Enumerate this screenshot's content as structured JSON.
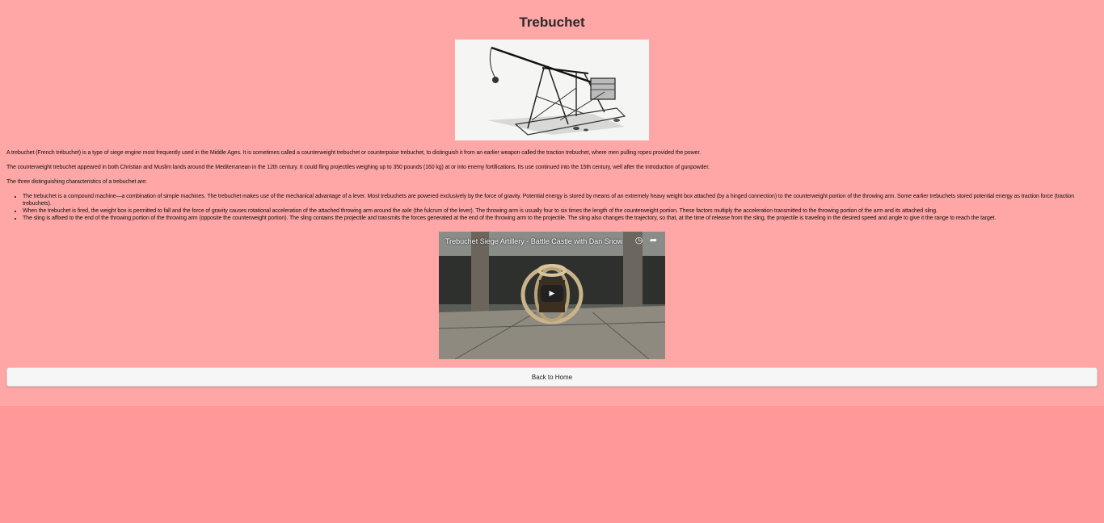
{
  "title": "Trebuchet",
  "image": {
    "icon": "trebuchet-illustration"
  },
  "paragraphs": {
    "intro": "A trebuchet (French trébuchet) is a type of siege engine most frequently used in the Middle Ages. It is sometimes called a counterweight trebuchet or counterpoise trebuchet, to distinguish it from an earlier weapon called the traction trebuchet, where men pulling ropes provided the power.",
    "history": "The counterweight trebuchet appeared in both Christian and Muslim lands around the Mediterranean in the 12th century. It could fling projectiles weighing up to 350 pounds (160 kg) at or into enemy fortifications. Its use continued into the 15th century, well after the introduction of gunpowder.",
    "lead": "The three distinguishing characteristics of a trebuchet are:"
  },
  "characteristics": [
    "The trebuchet is a compound machine—a combination of simple machines. The trebuchet makes use of the mechanical advantage of a lever. Most trebuchets are powered exclusively by the force of gravity. Potential energy is stored by means of an extremely heavy weight box attached (by a hinged connection) to the counterweight portion of the throwing arm. Some earlier trebuchets stored potential energy as traction force (traction trebuchets).",
    "When the trebuchet is fired, the weight box is permitted to fall and the force of gravity causes rotational acceleration of the attached throwing arm around the axle (the fulcrum of the lever). The throwing arm is usually four to six times the length of the counterweight portion. These factors multiply the acceleration transmitted to the throwing portion of the arm and its attached sling.",
    "The sling is affixed to the end of the throwing portion of the throwing arm (opposite the counterweight portion). The sling contains the projectile and transmits the forces generated at the end of the throwing arm to the projectile. The sling also changes the trajectory, so that, at the time of release from the sling, the projectile is traveling in the desired speed and angle to give it the range to reach the target."
  ],
  "video": {
    "title": "Trebuchet Siege Artillery - Battle Castle with Dan Snow",
    "watch_later_icon": "clock-icon",
    "share_icon": "share-icon",
    "play_icon": "play-icon"
  },
  "back_button": "Back to Home",
  "colors": {
    "page_bg": "#ffa6a6",
    "body_bg": "#ff9999",
    "button_bg": "#f6f6f6"
  }
}
